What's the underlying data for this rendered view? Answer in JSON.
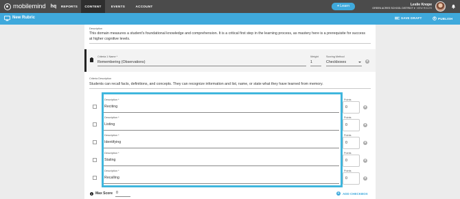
{
  "nav": {
    "logo_text": "mobilemind",
    "hq_label": "hq",
    "items": [
      {
        "label": "REPORTS",
        "active": false
      },
      {
        "label": "CONTENT",
        "active": true
      },
      {
        "label": "EVENTS",
        "active": false
      },
      {
        "label": "ACCOUNT",
        "active": false
      }
    ],
    "learn_label": "Learn",
    "user_name": "Leslie Knope",
    "district": "GREEN ACRES SCHOOL DISTRICT",
    "role": "VIEW ROLES"
  },
  "toolbar": {
    "title": "New Rubric",
    "save_draft": "SAVE DRAFT",
    "publish": "PUBLISH"
  },
  "domain": {
    "description_label": "Description",
    "description": "This domain measures a student's foundational knowledge and comprehension. It is a critical first step in the learning process, as mastery here is a prerequisite for success at higher cognitive levels."
  },
  "criteria": {
    "name_label": "Criteria 1 Name *",
    "name_value": "Remembering (Observations)",
    "weight_label": "Weight",
    "weight_value": "1",
    "scoring_label": "Scoring Method",
    "scoring_value": "Checkboxes",
    "description_label": "Criteria Description",
    "description": "Students can recall facts, definitions, and concepts. They can recognize information and list, name, or state what they have learned from memory."
  },
  "checkbox_field_label": "Description *",
  "points_label": "Points",
  "items": [
    {
      "description": "Reciting",
      "points": "0"
    },
    {
      "description": "Listing",
      "points": "0"
    },
    {
      "description": "Identifying",
      "points": "0"
    },
    {
      "description": "Stating",
      "points": "0"
    },
    {
      "description": "Recalling",
      "points": "0"
    }
  ],
  "footer": {
    "max_score_label": "Max Score",
    "max_score_value": "0",
    "add_checkbox": "ADD CHECKBOX"
  },
  "colors": {
    "accent": "#3fa9dc",
    "highlight": "#3fb6dd",
    "nav_bg": "#4b4b4b"
  }
}
